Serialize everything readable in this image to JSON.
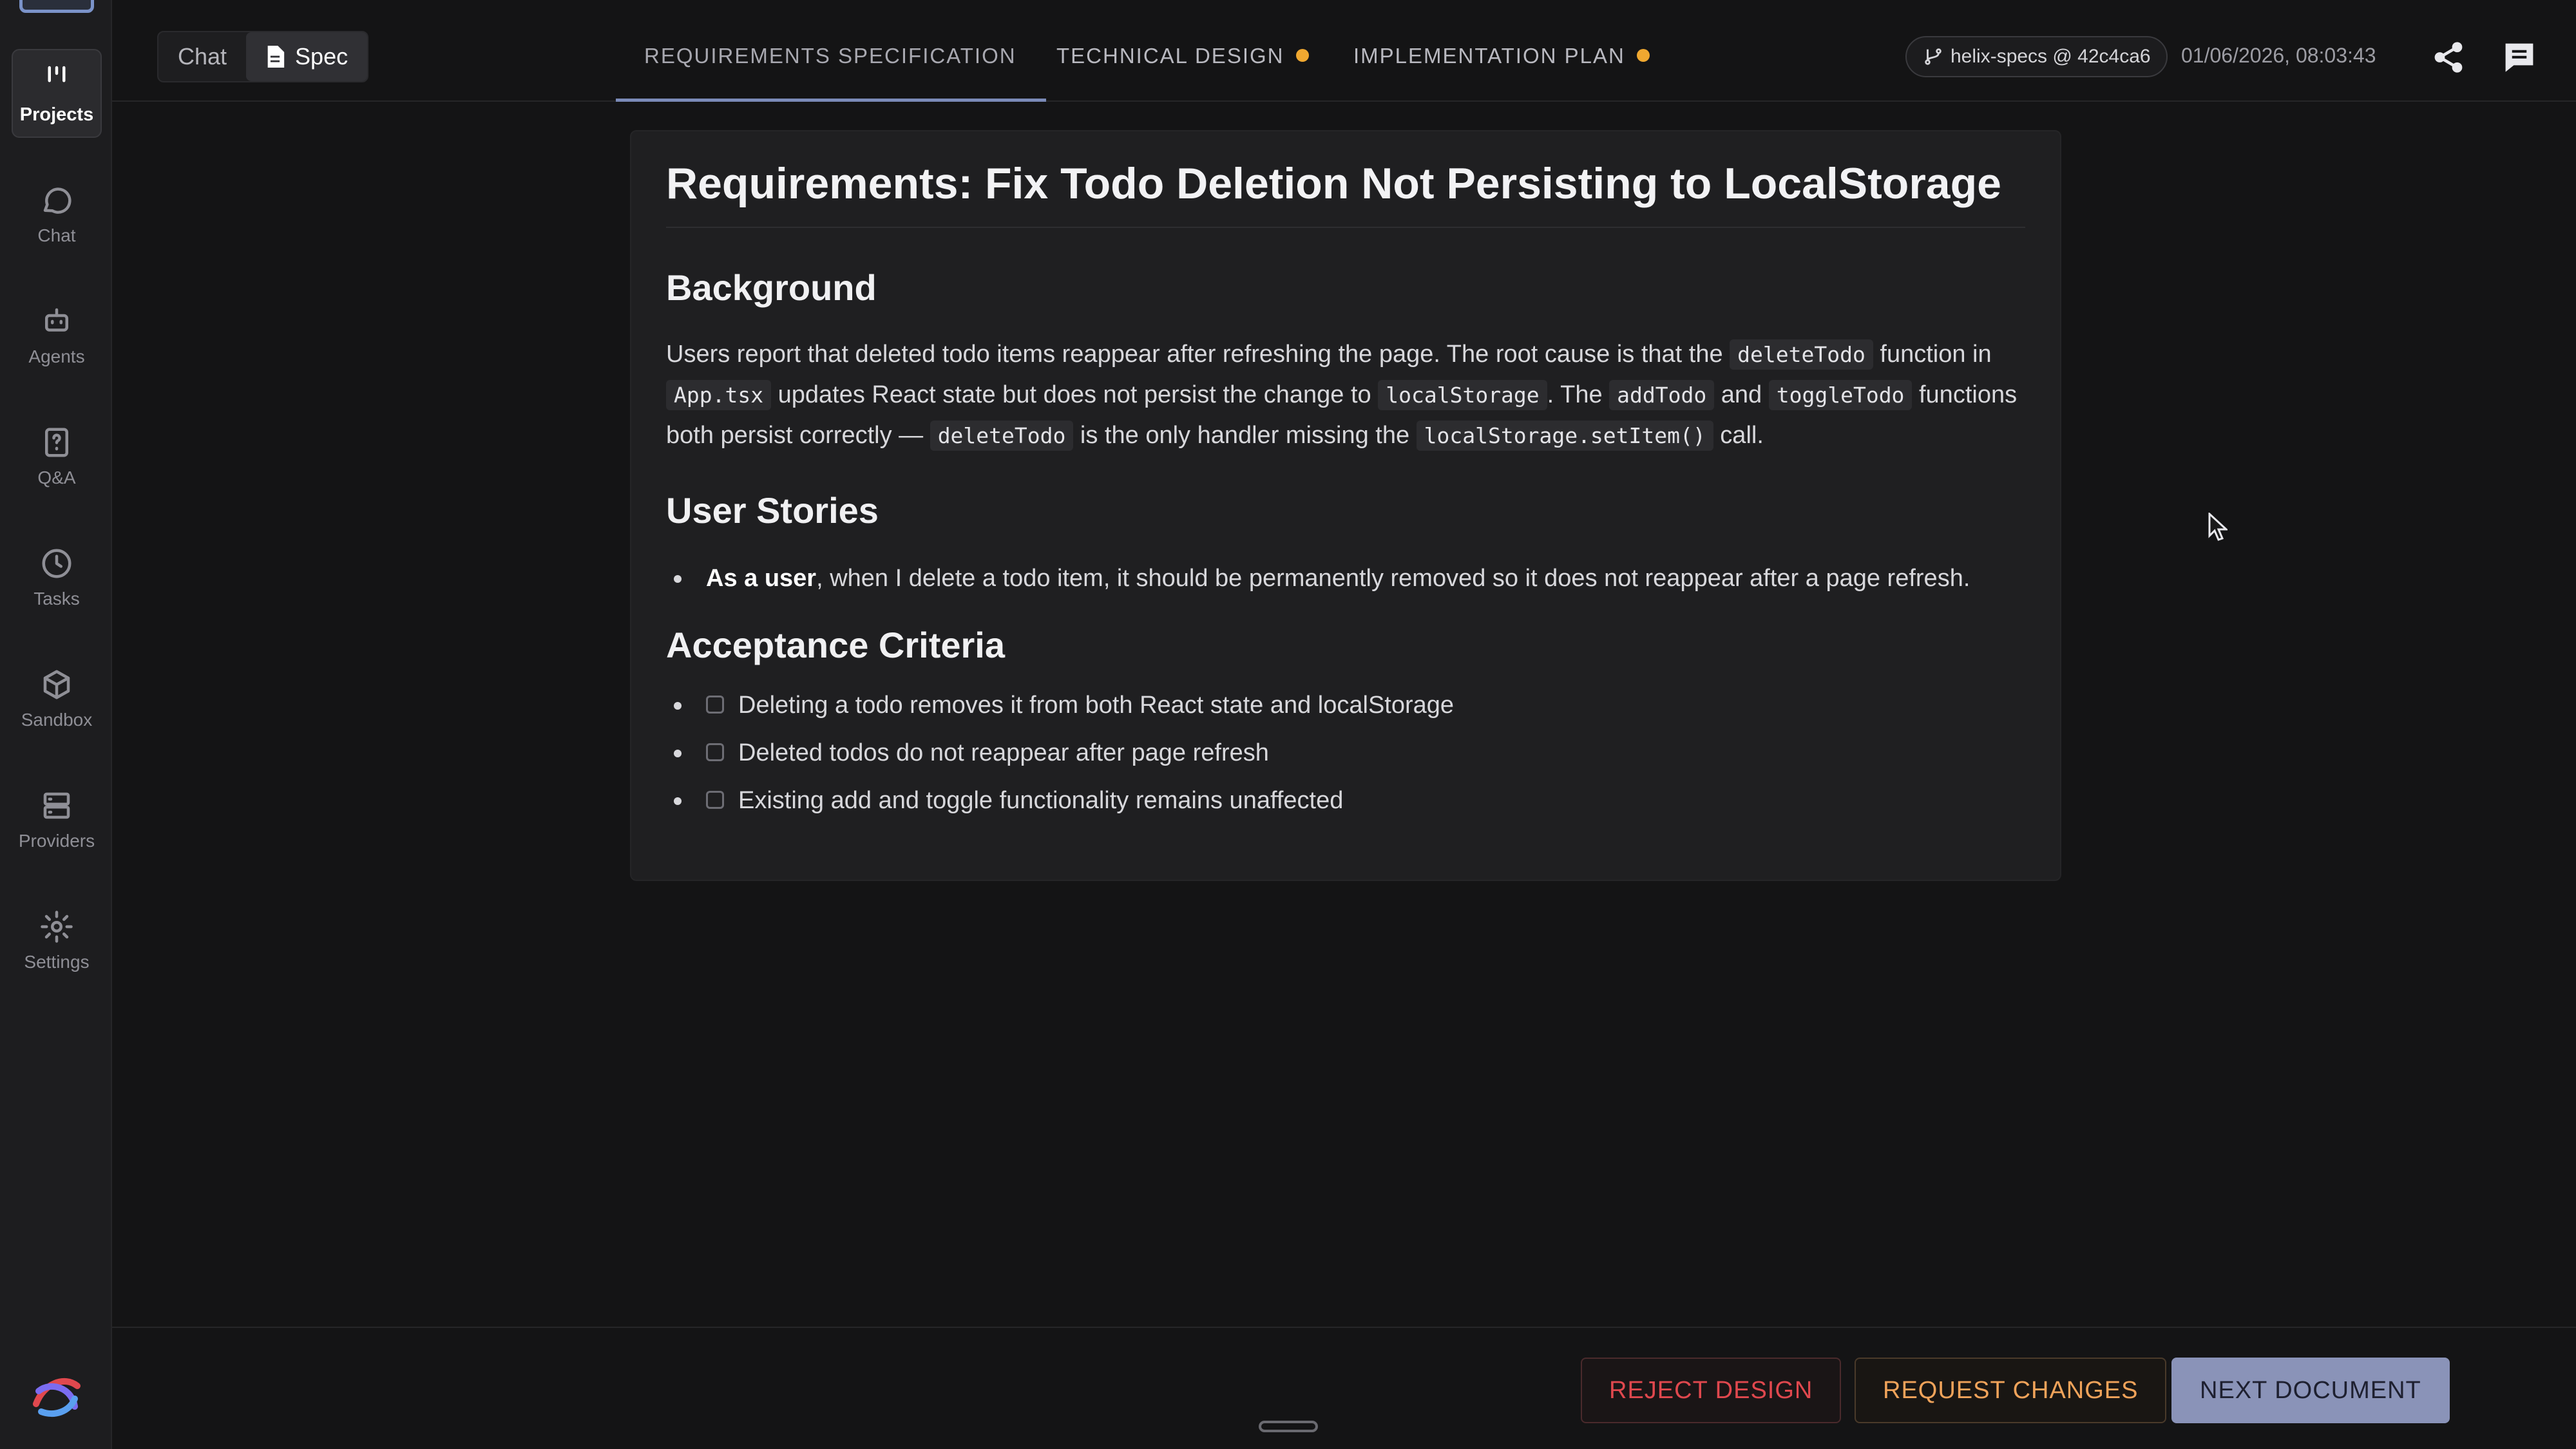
{
  "sidebar": {
    "items": [
      {
        "label": "Projects",
        "icon": "projects-icon",
        "active": true
      },
      {
        "label": "Chat",
        "icon": "chat-bubble-icon"
      },
      {
        "label": "Agents",
        "icon": "robot-icon"
      },
      {
        "label": "Q&A",
        "icon": "question-doc-icon"
      },
      {
        "label": "Tasks",
        "icon": "clock-icon"
      },
      {
        "label": "Sandbox",
        "icon": "cube-icon"
      },
      {
        "label": "Providers",
        "icon": "server-icon"
      },
      {
        "label": "Settings",
        "icon": "gear-icon"
      }
    ]
  },
  "header": {
    "mode_chat": "Chat",
    "mode_spec": "Spec",
    "tabs": [
      {
        "label": "REQUIREMENTS SPECIFICATION",
        "active": true
      },
      {
        "label": "TECHNICAL DESIGN",
        "status_color": "#f0a830"
      },
      {
        "label": "IMPLEMENTATION PLAN",
        "status_color": "#f0a830"
      }
    ],
    "branch": "helix-specs @ 42c4ca6",
    "timestamp": "01/06/2026, 08:03:43"
  },
  "doc": {
    "title": "Requirements: Fix Todo Deletion Not Persisting to LocalStorage",
    "background_heading": "Background",
    "bg": {
      "t1": "Users report that deleted todo items reappear after refreshing the page. The root cause is that the ",
      "c1": "deleteTodo",
      "t2": " function in ",
      "c2": "App.tsx",
      "t3": " updates React state but does not persist the change to ",
      "c3": "localStorage",
      "t4": ". The ",
      "c4": "addTodo",
      "t5": " and ",
      "c5": "toggleTodo",
      "t6": " functions both persist correctly — ",
      "c6": "deleteTodo",
      "t7": " is the only handler missing the ",
      "c7": "localStorage.setItem()",
      "t8": " call."
    },
    "stories_heading": "User Stories",
    "story_bold": "As a user",
    "story_text": ", when I delete a todo item, it should be permanently removed so it does not reappear after a page refresh.",
    "criteria_heading": "Acceptance Criteria",
    "criteria": [
      "Deleting a todo removes it from both React state and localStorage",
      "Deleted todos do not reappear after page refresh",
      "Existing add and toggle functionality remains unaffected"
    ]
  },
  "footer": {
    "reject": "REJECT DESIGN",
    "request": "REQUEST CHANGES",
    "next": "NEXT DOCUMENT"
  },
  "colors": {
    "accent": "#7b8bb8",
    "reject": "#e0484e",
    "request": "#f0a35a",
    "pending_dot": "#f0a830"
  }
}
